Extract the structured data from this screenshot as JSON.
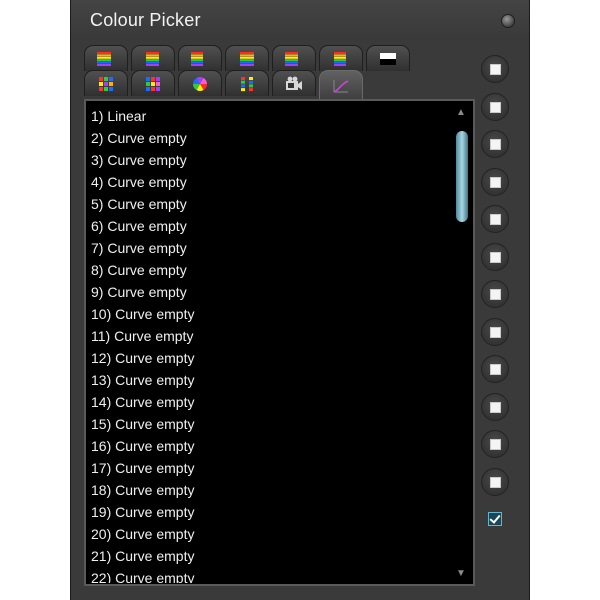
{
  "window": {
    "title": "Colour Picker"
  },
  "tabs": {
    "row1": [
      {
        "icon": "colour-bands-icon"
      },
      {
        "icon": "colour-bands-icon"
      },
      {
        "icon": "colour-bands-icon"
      },
      {
        "icon": "colour-bands-icon"
      },
      {
        "icon": "colour-bands-icon"
      },
      {
        "icon": "colour-bands-icon"
      },
      {
        "icon": "black-white-icon"
      }
    ],
    "row2": [
      {
        "icon": "colour-grid-icon"
      },
      {
        "icon": "colour-grid-icon"
      },
      {
        "icon": "colour-wheel-icon"
      },
      {
        "icon": "colour-swatches-icon"
      },
      {
        "icon": "camera-icon"
      },
      {
        "icon": "curve-icon",
        "active": true
      }
    ]
  },
  "list": {
    "items": [
      "1) Linear",
      "2) Curve empty",
      "3) Curve empty",
      "4) Curve empty",
      "5) Curve empty",
      "6) Curve empty",
      "7) Curve empty",
      "8) Curve empty",
      "9) Curve empty",
      "10) Curve empty",
      "11) Curve empty",
      "12) Curve empty",
      "13) Curve empty",
      "14) Curve empty",
      "15) Curve empty",
      "16) Curve empty",
      "17) Curve empty",
      "18) Curve empty",
      "19) Curve empty",
      "20) Curve empty",
      "21) Curve empty",
      "22) Curve empty"
    ]
  },
  "side_checkboxes": [
    false,
    false,
    false,
    false,
    false,
    false,
    false,
    false,
    false,
    false,
    false,
    false,
    true
  ],
  "colors": {
    "window_bg": "#3a3a3a",
    "list_bg": "#000000",
    "scroll_accent": "#7fb8c9",
    "check_accent": "#16485a"
  }
}
